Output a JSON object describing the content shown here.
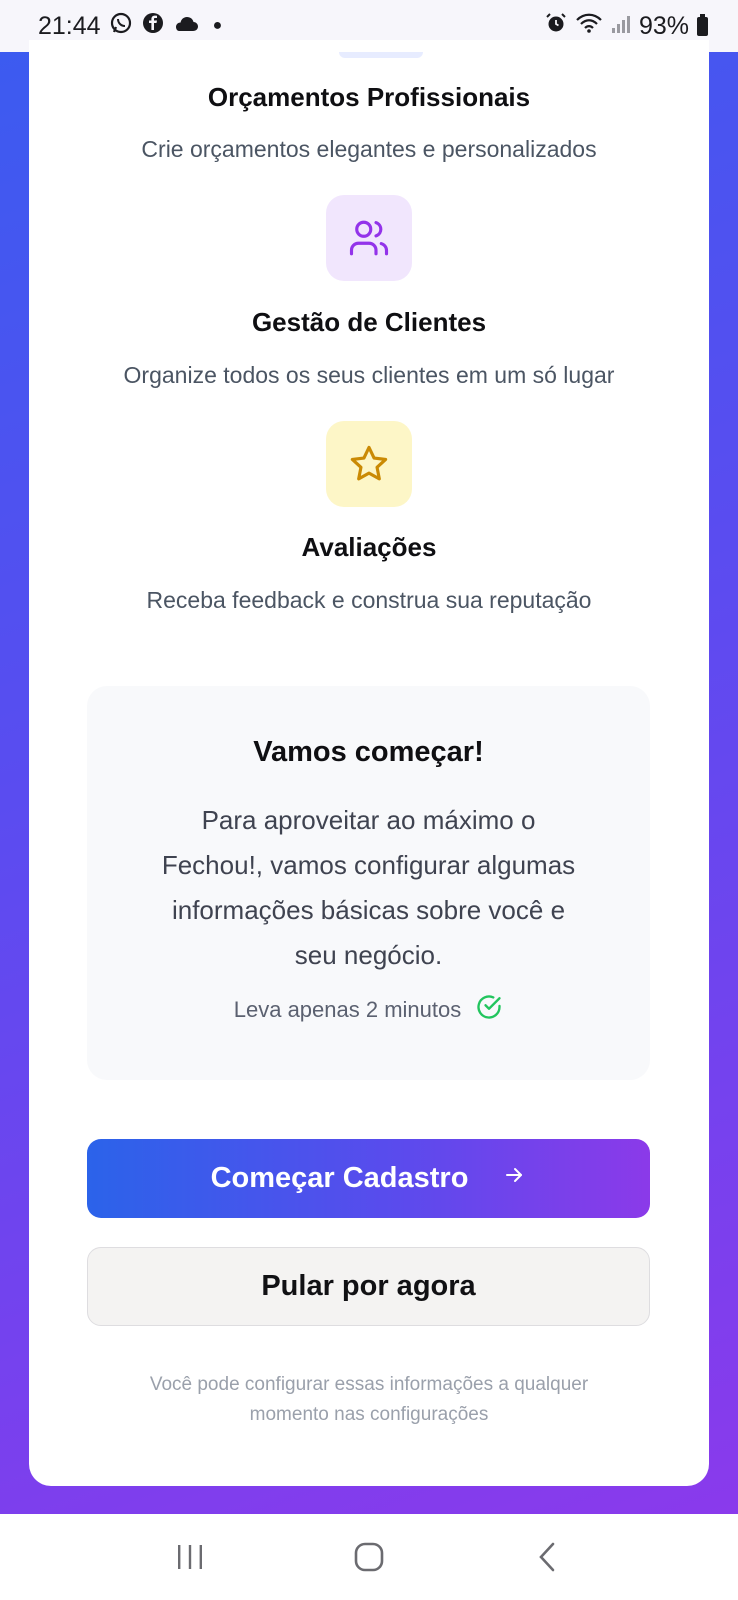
{
  "status_bar": {
    "time": "21:44",
    "notification_icons": [
      "whatsapp-icon",
      "facebook-icon",
      "cloud-icon"
    ],
    "battery": "93%"
  },
  "features": [
    {
      "title": "Orçamentos Profissionais",
      "description": "Crie orçamentos elegantes e personalizados"
    },
    {
      "title": "Gestão de Clientes",
      "description": "Organize todos os seus clientes em um só lugar",
      "icon": "users-icon",
      "icon_color": "#9333ea"
    },
    {
      "title": "Avaliações",
      "description": "Receba feedback e construa sua reputação",
      "icon": "star-icon",
      "icon_color": "#ca8a04"
    }
  ],
  "info_box": {
    "title": "Vamos começar!",
    "lines": [
      "Para aproveitar ao máximo o",
      "Fechou!, vamos configurar algumas",
      "informações básicas sobre você e",
      "seu negócio."
    ],
    "note": "Leva apenas 2 minutos",
    "note_icon": "check-circle-icon",
    "note_icon_color": "#22c55e"
  },
  "buttons": {
    "primary": "Começar Cadastro",
    "primary_icon": "arrow-right-icon",
    "secondary": "Pular por agora"
  },
  "footnote_lines": [
    "Você pode configurar essas informações a qualquer",
    "momento nas configurações"
  ],
  "colors": {
    "gradient_start": "#2b63ea",
    "gradient_end": "#8b3ae9"
  }
}
